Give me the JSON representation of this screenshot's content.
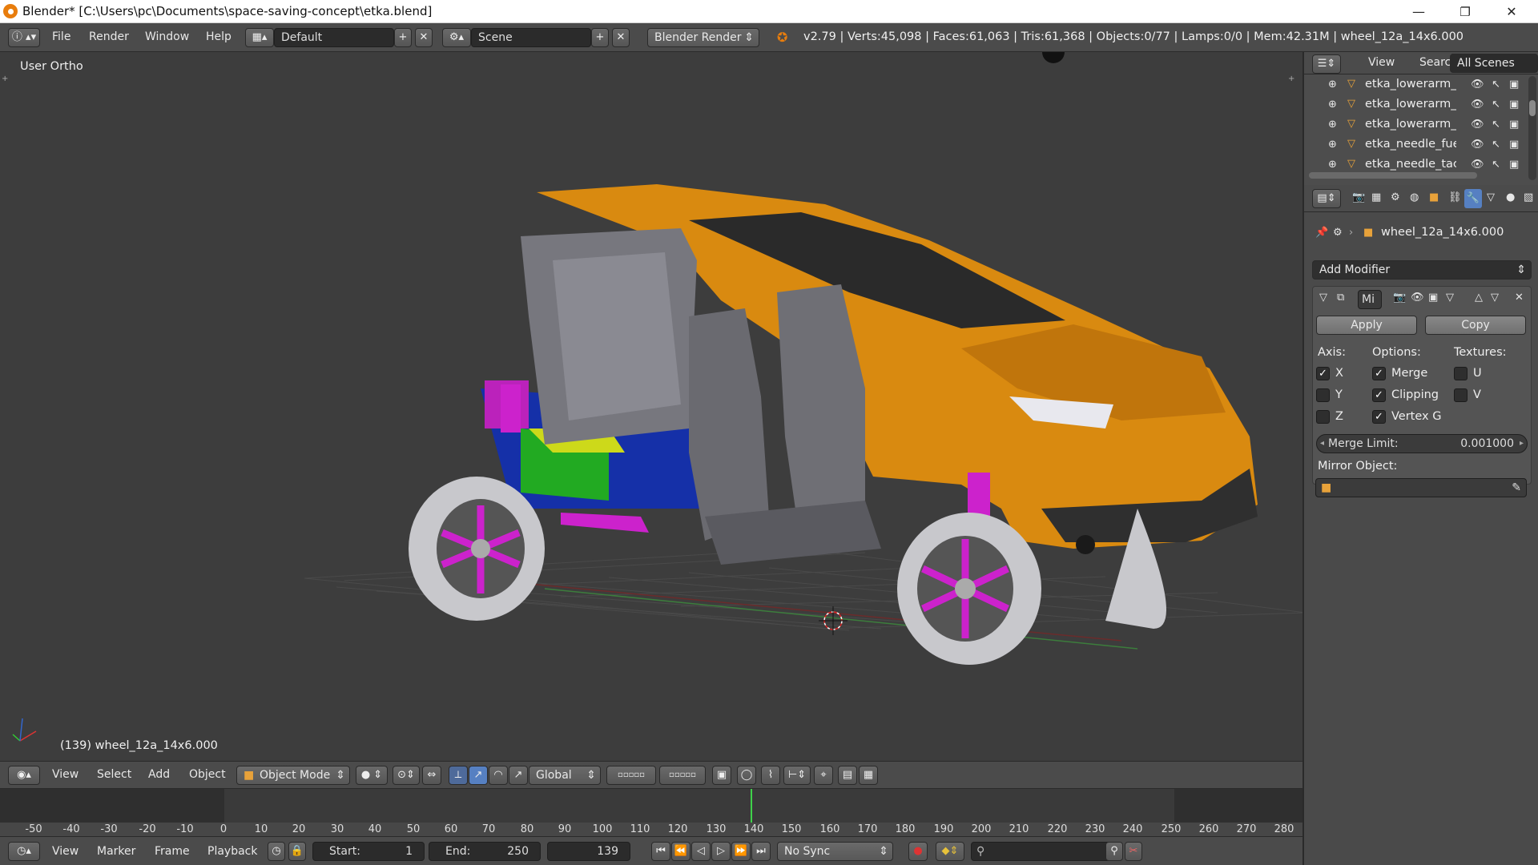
{
  "titlebar": {
    "title": "Blender* [C:\\Users\\pc\\Documents\\space-saving-concept\\etka.blend]",
    "minimize": "—",
    "restore": "❐",
    "close": "✕"
  },
  "infobar": {
    "menus": [
      "File",
      "Render",
      "Window",
      "Help"
    ],
    "layout": "Default",
    "scene": "Scene",
    "engine": "Blender Render",
    "stats": "v2.79 | Verts:45,098 | Faces:61,063 | Tris:61,368 | Objects:0/77 | Lamps:0/0 | Mem:42.31M | wheel_12a_14x6.000"
  },
  "viewport": {
    "view_label": "User Ortho",
    "object_label": "(139) wheel_12a_14x6.000"
  },
  "view3d_header": {
    "menus": [
      "View",
      "Select",
      "Add",
      "Object"
    ],
    "mode": "Object Mode",
    "orientation": "Global"
  },
  "timeline": {
    "ticks": [
      "-50",
      "-40",
      "-30",
      "-20",
      "-10",
      "0",
      "10",
      "20",
      "30",
      "40",
      "50",
      "60",
      "70",
      "80",
      "90",
      "100",
      "110",
      "120",
      "130",
      "140",
      "150",
      "160",
      "170",
      "180",
      "190",
      "200",
      "210",
      "220",
      "230",
      "240",
      "250",
      "260",
      "270",
      "280"
    ],
    "menus": [
      "View",
      "Marker",
      "Frame",
      "Playback"
    ],
    "start_label": "Start:",
    "start_value": "1",
    "end_label": "End:",
    "end_value": "250",
    "current_frame": "139",
    "sync": "No Sync"
  },
  "outliner": {
    "header": [
      "View",
      "Search",
      "All Scenes"
    ],
    "rows": [
      "etka_lowerarm_a_",
      "etka_lowerarm_b_",
      "etka_lowerarm_b_",
      "etka_needle_fuel",
      "etka_needle_tachc"
    ]
  },
  "properties": {
    "object_name": "wheel_12a_14x6.000",
    "add_modifier": "Add Modifier",
    "modifier_name": "Mi",
    "apply": "Apply",
    "copy": "Copy",
    "axis_label": "Axis:",
    "options_label": "Options:",
    "textures_label": "Textures:",
    "axis": [
      {
        "label": "X",
        "checked": true
      },
      {
        "label": "Y",
        "checked": false
      },
      {
        "label": "Z",
        "checked": false
      }
    ],
    "options": [
      {
        "label": "Merge",
        "checked": true
      },
      {
        "label": "Clipping",
        "checked": true
      },
      {
        "label": "Vertex G",
        "checked": true
      }
    ],
    "textures": [
      {
        "label": "U",
        "checked": false
      },
      {
        "label": "V",
        "checked": false
      }
    ],
    "merge_limit_label": "Merge Limit:",
    "merge_limit_value": "0.001000",
    "mirror_object_label": "Mirror Object:"
  },
  "colors": {
    "body": "#d98a10",
    "seat": "#6f6f75",
    "rim": "#cc22cc",
    "tire": "#c8c8cc",
    "active_blue": "#5680c2"
  }
}
